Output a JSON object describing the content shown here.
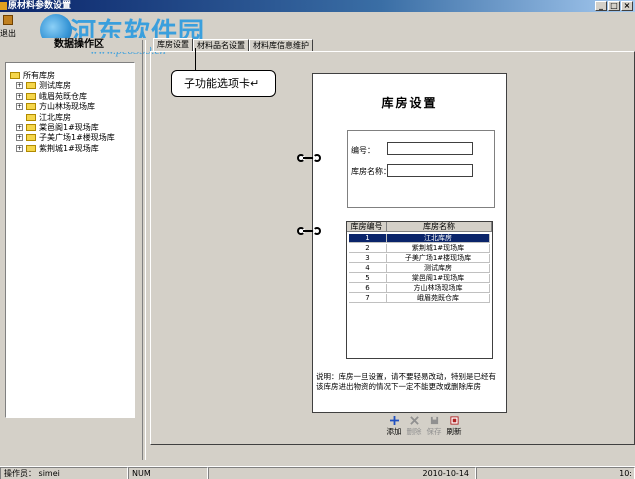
{
  "window": {
    "title": "原材料参数设置",
    "buttons": [
      "_",
      "□",
      "×"
    ]
  },
  "watermark": {
    "title": "河东软件园",
    "url": "www.pc0359.cn"
  },
  "toolbar": {
    "exit_label": "退出"
  },
  "left_panel": {
    "header": "数据操作区",
    "tree": [
      {
        "label": "所有库房",
        "level": 0,
        "expandable": false
      },
      {
        "label": "测试库房",
        "level": 1,
        "expandable": true
      },
      {
        "label": "峨眉苑既仓库",
        "level": 1,
        "expandable": true
      },
      {
        "label": "方山林场现场库",
        "level": 1,
        "expandable": true
      },
      {
        "label": "江北库房",
        "level": 1,
        "expandable": false
      },
      {
        "label": "棠邑阁1#现场库",
        "level": 1,
        "expandable": true
      },
      {
        "label": "子美广场1#楼现场库",
        "level": 1,
        "expandable": true
      },
      {
        "label": "紫荆城1#现场库",
        "level": 1,
        "expandable": true
      }
    ]
  },
  "tabs": [
    {
      "label": "库房设置",
      "active": true
    },
    {
      "label": "材料品名设置",
      "active": false
    },
    {
      "label": "材料库信息维护",
      "active": false
    }
  ],
  "callout": {
    "text": "子功能选项卡↵"
  },
  "form": {
    "title": "库房设置",
    "fields": [
      {
        "label": "编号：",
        "value": ""
      },
      {
        "label": "库房名称：",
        "value": ""
      }
    ]
  },
  "grid": {
    "columns": [
      "库房编号",
      "库房名称"
    ],
    "rows": [
      {
        "id": "1",
        "name": "江北库房",
        "selected": true
      },
      {
        "id": "2",
        "name": "紫荆城1#现场库",
        "selected": false
      },
      {
        "id": "3",
        "name": "子美广场1#楼现场库",
        "selected": false
      },
      {
        "id": "4",
        "name": "测试库房",
        "selected": false
      },
      {
        "id": "5",
        "name": "棠邑阁1#现场库",
        "selected": false
      },
      {
        "id": "6",
        "name": "方山林场现场库",
        "selected": false
      },
      {
        "id": "7",
        "name": "峨眉苑既仓库",
        "selected": false
      }
    ]
  },
  "note": "说明：库房一旦设置，请不要轻易改动，特别是已经有该库房进出物资的情况下一定不能更改或删除库房",
  "actions": [
    {
      "label": "添加",
      "icon": "add-icon",
      "enabled": true,
      "color": "#2050c0"
    },
    {
      "label": "删除",
      "icon": "delete-icon",
      "enabled": false,
      "color": "#909090"
    },
    {
      "label": "保存",
      "icon": "save-icon",
      "enabled": false,
      "color": "#909090"
    },
    {
      "label": "刷新",
      "icon": "refresh-icon",
      "enabled": true,
      "color": "#b02020"
    }
  ],
  "statusbar": {
    "operator": "操作员：  simei",
    "num": "NUM",
    "date": "2010-10-14",
    "time": "10:"
  }
}
